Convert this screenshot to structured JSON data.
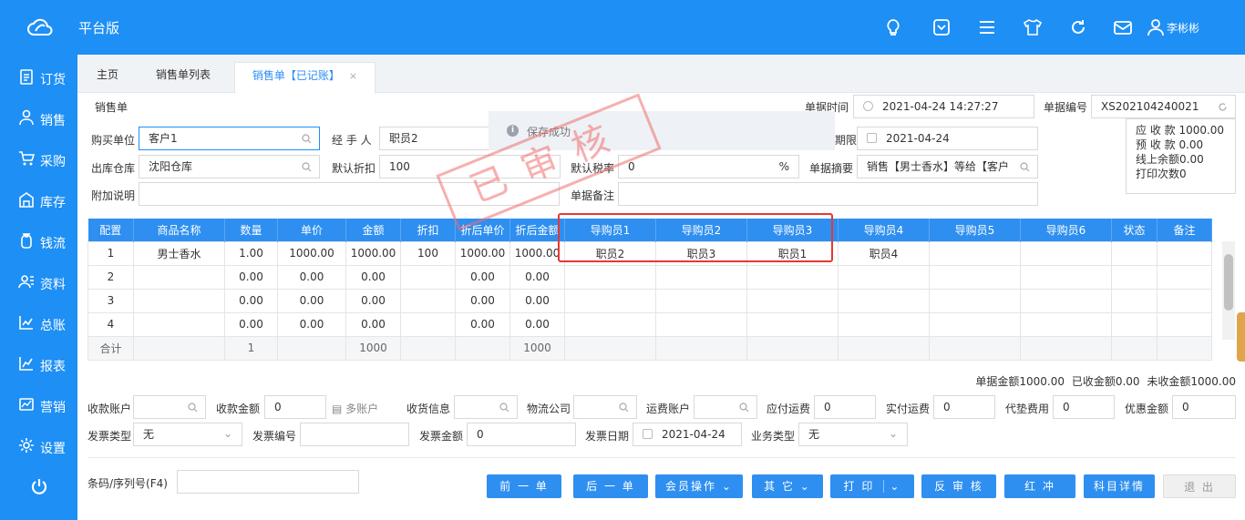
{
  "app": {
    "brand": "平台版",
    "user": "李彬彬"
  },
  "sidebar": [
    "订货",
    "销售",
    "采购",
    "库存",
    "钱流",
    "资料",
    "总账",
    "报表",
    "营销",
    "设置"
  ],
  "tabs": [
    {
      "label": "主页"
    },
    {
      "label": "销售单列表"
    },
    {
      "label": "销售单【已记账】",
      "close": "×"
    }
  ],
  "form": {
    "title": "销售单",
    "doc_time_label": "单据时间",
    "doc_time": "2021-04-24 14:27:27",
    "doc_no_label": "单据编号",
    "doc_no": "XS202104240021",
    "buyer_label": "购买单位",
    "buyer": "客户1",
    "handler_label": "经 手 人",
    "handler": "职员2",
    "deadline_label": "期限",
    "deadline": "2021-04-24",
    "warehouse_label": "出库仓库",
    "warehouse": "沈阳仓库",
    "discount_label": "默认折扣",
    "discount": "100",
    "tax_label": "默认税率",
    "tax": "0",
    "tax_unit": "%",
    "summary_label": "单据摘要",
    "summary": "销售【男士香水】等给【客户",
    "note_label": "附加说明",
    "note": "",
    "remark_label": "单据备注",
    "remark": ""
  },
  "summary_box": [
    "应 收 款 1000.00",
    "预 收 款 0.00",
    "线上余额0.00",
    "打印次数0"
  ],
  "toast": {
    "icon": "i",
    "text": "保存成功"
  },
  "stamp": "已审核",
  "table": {
    "headers": [
      "配置",
      "商品名称",
      "数量",
      "单价",
      "金额",
      "折扣",
      "折后单价",
      "折后金额",
      "导购员1",
      "导购员2",
      "导购员3",
      "导购员4",
      "导购员5",
      "导购员6",
      "状态",
      "备注"
    ],
    "rows": [
      [
        "1",
        "男士香水",
        "1.00",
        "1000.00",
        "1000.00",
        "100",
        "1000.00",
        "1000.00",
        "职员2",
        "职员3",
        "职员1",
        "职员4",
        "",
        "",
        "",
        ""
      ],
      [
        "2",
        "",
        "0.00",
        "0.00",
        "0.00",
        "",
        "0.00",
        "0.00",
        "",
        "",
        "",
        "",
        "",
        "",
        "",
        ""
      ],
      [
        "3",
        "",
        "0.00",
        "0.00",
        "0.00",
        "",
        "0.00",
        "0.00",
        "",
        "",
        "",
        "",
        "",
        "",
        "",
        ""
      ],
      [
        "4",
        "",
        "0.00",
        "0.00",
        "0.00",
        "",
        "0.00",
        "0.00",
        "",
        "",
        "",
        "",
        "",
        "",
        "",
        ""
      ]
    ],
    "sum": [
      "合计",
      "",
      "1",
      "",
      "1000",
      "",
      "",
      "1000",
      "",
      "",
      "",
      "",
      "",
      "",
      "",
      ""
    ]
  },
  "totals": "单据金额1000.00  已收金额0.00  未收金额1000.00",
  "payment": {
    "account_label": "收款账户",
    "account": "",
    "amount_label": "收款金额",
    "amount": "0",
    "multi_label": "多账户",
    "ship_label": "收货信息",
    "ship": "",
    "logistics_label": "物流公司",
    "logistics": "",
    "freight_acct_label": "运费账户",
    "freight_acct": "",
    "freight_due_label": "应付运费",
    "freight_due": "0",
    "freight_paid_label": "实付运费",
    "freight_paid": "0",
    "advance_label": "代垫费用",
    "advance": "0",
    "discount_label": "优惠金额",
    "discount": "0",
    "inv_type_label": "发票类型",
    "inv_type": "无",
    "inv_no_label": "发票编号",
    "inv_no": "",
    "inv_amt_label": "发票金额",
    "inv_amt": "0",
    "inv_date_label": "发票日期",
    "inv_date": "2021-04-24",
    "biz_type_label": "业务类型",
    "biz_type": "无"
  },
  "barcode_label": "条码/序列号(F4)",
  "buttons": [
    "前 一 单",
    "后 一 单",
    "会员操作",
    "其 它",
    "打 印",
    "反 审 核",
    "红  冲",
    "科目详情",
    "退  出"
  ]
}
